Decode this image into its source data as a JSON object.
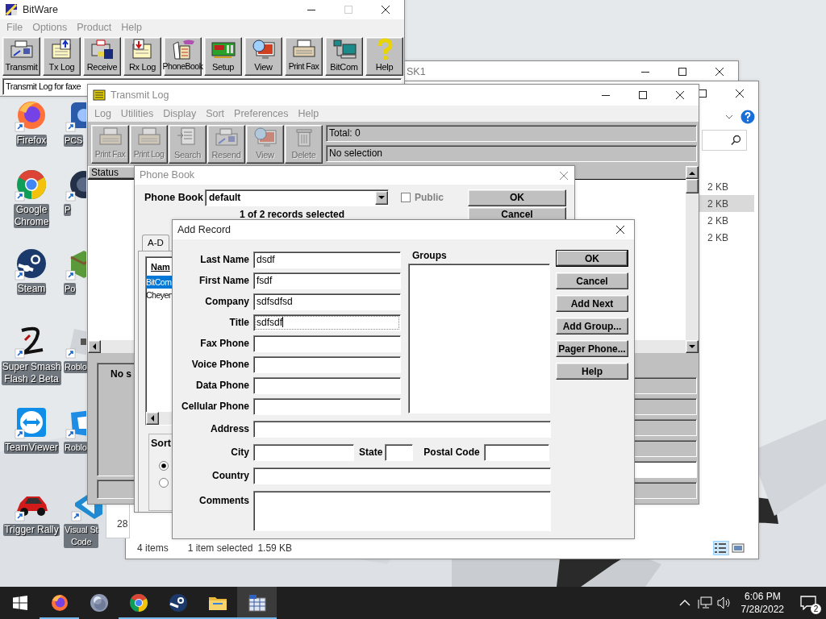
{
  "desktop": {
    "icons": [
      {
        "lines": [
          "Firefox"
        ]
      },
      {
        "lines": [
          "Google",
          "Chrome"
        ]
      },
      {
        "lines": [
          "Steam"
        ]
      },
      {
        "lines": [
          "Super Smash",
          "Flash 2 Beta"
        ]
      },
      {
        "lines": [
          "TeamViewer"
        ]
      },
      {
        "lines": [
          "Trigger Rally"
        ]
      }
    ],
    "icons_column_2": [
      {
        "lines": [
          "PCS"
        ]
      },
      {
        "lines": [
          "P"
        ]
      },
      {
        "lines": [
          "Po"
        ]
      },
      {
        "lines": [
          "Roblo"
        ]
      },
      {
        "lines": [
          "Roblo"
        ]
      },
      {
        "lines": [
          "Visual St",
          "Code"
        ]
      }
    ]
  },
  "explorer_back": {
    "title": "SK1"
  },
  "explorer": {
    "sizes": [
      {
        "text": "2 KB",
        "selected": false
      },
      {
        "text": "2 KB",
        "selected": true
      },
      {
        "text": "2 KB",
        "selected": false
      },
      {
        "text": "2 KB",
        "selected": false
      }
    ],
    "item_count": "4 items",
    "selection_info": "1 item selected",
    "selection_size": "1.59 KB",
    "view_buttons": [
      {
        "selected": true
      },
      {
        "selected": false
      }
    ]
  },
  "partial_window": {
    "text": "28"
  },
  "bitware": {
    "title": "BitWare",
    "menu": [
      {
        "label": "File",
        "disabled": true
      },
      {
        "label": "Options",
        "disabled": true
      },
      {
        "label": "Product",
        "disabled": true
      },
      {
        "label": "Help",
        "disabled": true
      }
    ],
    "toolbar": [
      {
        "label": "Transmit",
        "disabled": false
      },
      {
        "label": "Tx Log",
        "disabled": false
      },
      {
        "label": "Receive",
        "disabled": false
      },
      {
        "label": "Rx Log",
        "disabled": false
      },
      {
        "label": "PhoneBook",
        "disabled": false
      },
      {
        "label": "Setup",
        "disabled": false
      },
      {
        "label": "View",
        "disabled": false
      },
      {
        "label": "Print Fax",
        "disabled": false
      },
      {
        "label": "BitCom",
        "disabled": false
      },
      {
        "label": "Help",
        "disabled": false
      }
    ],
    "status": "Transmit Log for faxe"
  },
  "transmit_log": {
    "title": "Transmit Log",
    "menu": [
      {
        "label": "Log",
        "disabled": true
      },
      {
        "label": "Utilities",
        "disabled": true
      },
      {
        "label": "Display",
        "disabled": true
      },
      {
        "label": "Sort",
        "disabled": true
      },
      {
        "label": "Preferences",
        "disabled": true
      },
      {
        "label": "Help",
        "disabled": true
      }
    ],
    "toolbar": [
      {
        "label": "Print Fax",
        "disabled": true
      },
      {
        "label": "Print Log",
        "disabled": true
      },
      {
        "label": "Search",
        "disabled": true
      },
      {
        "label": "Resend",
        "disabled": true
      },
      {
        "label": "View",
        "disabled": true
      },
      {
        "label": "Delete",
        "disabled": true
      }
    ],
    "total": "Total: 0",
    "selection": "No selection",
    "columns": [
      "Status"
    ],
    "detail_text": "No s"
  },
  "phone_book": {
    "title": "Phone Book",
    "label": "Phone Book",
    "combo_value": "default",
    "public": {
      "label": "Public",
      "checked": false
    },
    "buttons": [
      "OK",
      "Cancel"
    ],
    "summary": "1 of 2 records selected",
    "tabs": [
      {
        "label": "A-D",
        "selected": true
      }
    ],
    "list_header": "Nam",
    "items": [
      {
        "label": "BitCom",
        "selected": true
      },
      {
        "label": "Cheyen",
        "selected": false
      }
    ],
    "sort": {
      "label": "Sort",
      "radios": [
        {
          "selected": true
        },
        {
          "selected": false
        }
      ]
    }
  },
  "add_record": {
    "title": "Add Record",
    "fields": [
      {
        "label": "Last Name",
        "value": "dsdf",
        "focused": false
      },
      {
        "label": "First Name",
        "value": "fsdf",
        "focused": false
      },
      {
        "label": "Company",
        "value": "sdfsdfsd",
        "focused": false
      },
      {
        "label": "Title",
        "value": "sdfsdf",
        "focused": true
      },
      {
        "label": "Fax Phone",
        "focused": false
      },
      {
        "label": "Voice Phone",
        "focused": false
      },
      {
        "label": "Data Phone",
        "focused": false
      },
      {
        "label": "Cellular Phone",
        "focused": false
      }
    ],
    "groups_label": "Groups",
    "buttons": [
      {
        "label": "OK",
        "default": true
      },
      {
        "label": "Cancel",
        "default": false
      },
      {
        "label": "Add Next",
        "default": false
      },
      {
        "label": "Add Group...",
        "default": false
      },
      {
        "label": "Pager Phone...",
        "default": false
      },
      {
        "label": "Help",
        "default": false
      }
    ],
    "address_label": "Address",
    "city_label": "City",
    "state_label": "State",
    "postal_code_label": "Postal Code",
    "country_label": "Country",
    "comments_label": "Comments"
  },
  "taskbar": {
    "apps": [
      {
        "running": true,
        "active": false
      },
      {
        "running": false,
        "active": false
      },
      {
        "running": true,
        "active": false
      },
      {
        "running": true,
        "active": false
      },
      {
        "running": true,
        "active": false
      },
      {
        "running": true,
        "active": true
      }
    ],
    "time": "6:06 PM",
    "date": "7/28/2022",
    "notifications": "2"
  }
}
